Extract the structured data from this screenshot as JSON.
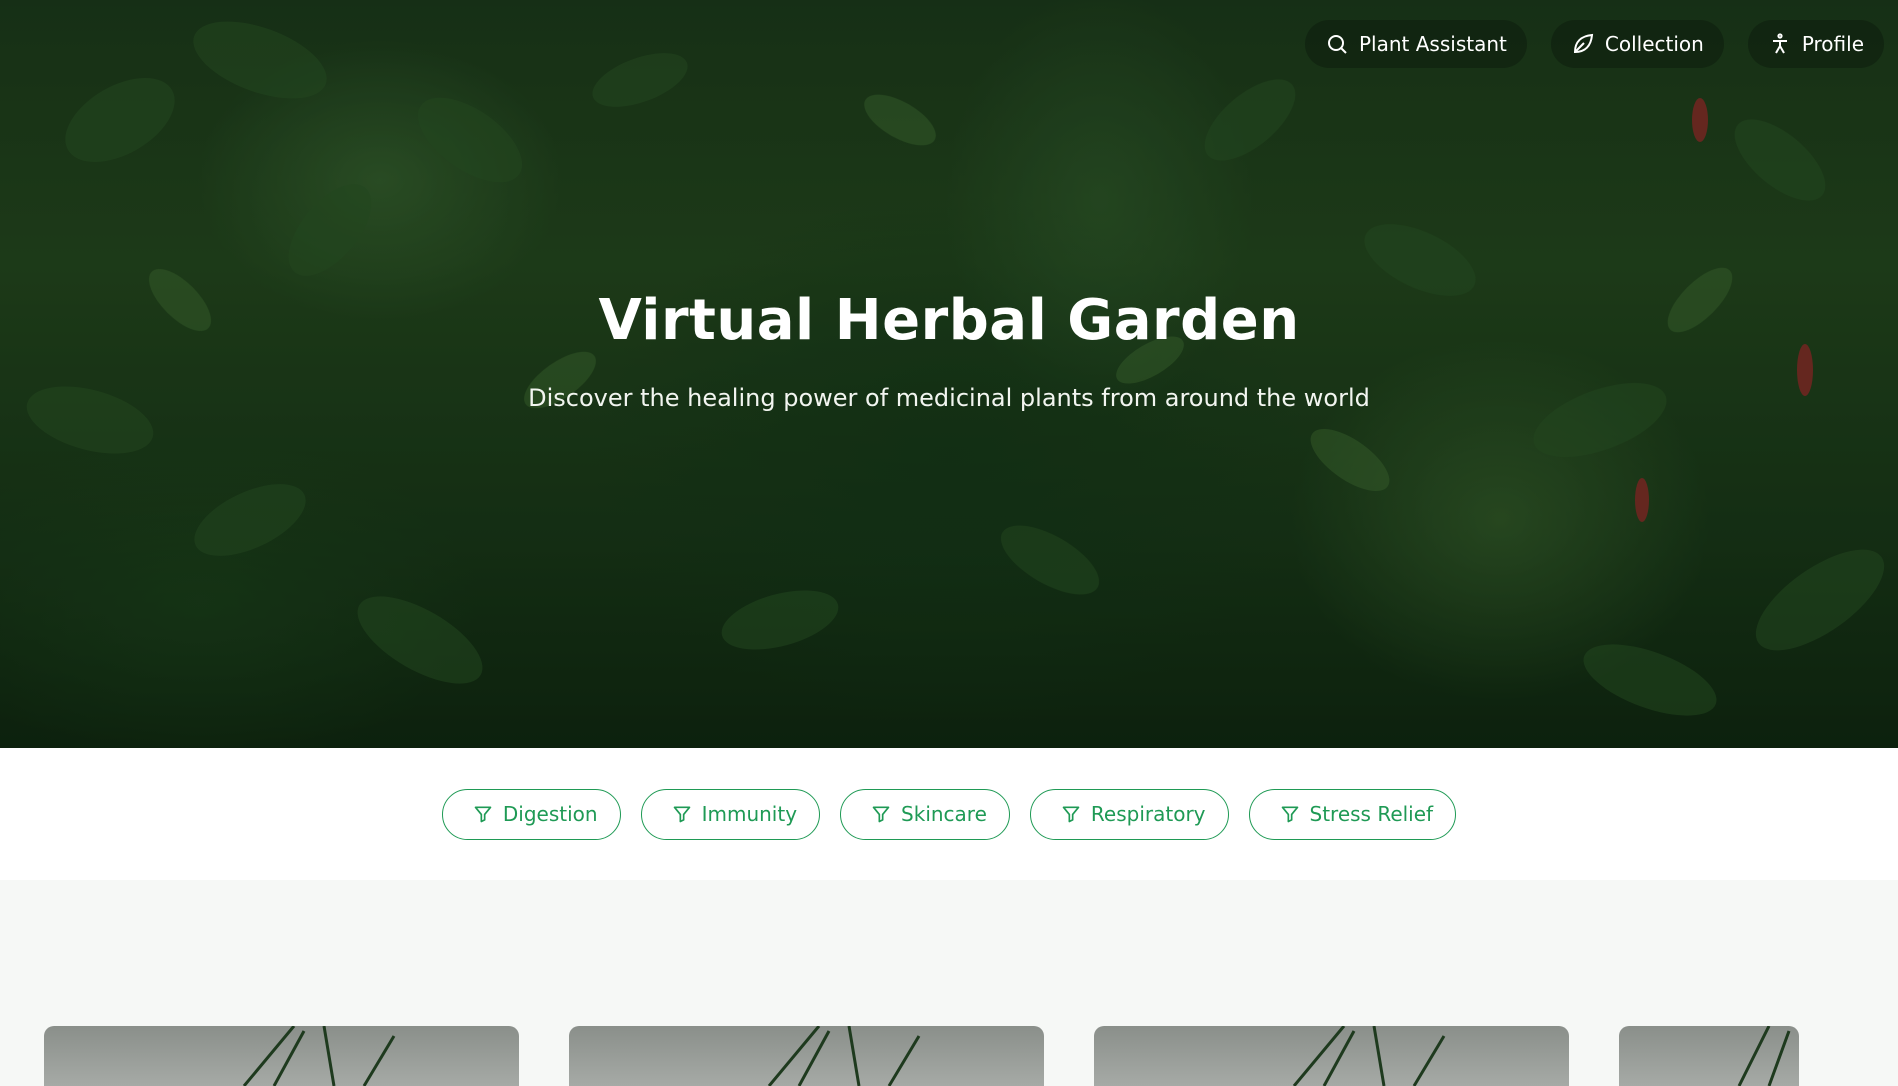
{
  "nav": {
    "items": [
      {
        "label": "Plant Assistant",
        "icon": "search-icon"
      },
      {
        "label": "Collection",
        "icon": "leaf-icon"
      },
      {
        "label": "Profile",
        "icon": "person-icon"
      }
    ]
  },
  "hero": {
    "title": "Virtual Herbal Garden",
    "subtitle": "Discover the healing power of medicinal plants from around the world"
  },
  "filters": [
    {
      "label": "Digestion",
      "icon": "filter-icon"
    },
    {
      "label": "Immunity",
      "icon": "filter-icon"
    },
    {
      "label": "Skincare",
      "icon": "filter-icon"
    },
    {
      "label": "Respiratory",
      "icon": "filter-icon"
    },
    {
      "label": "Stress Relief",
      "icon": "filter-icon"
    }
  ],
  "colors": {
    "accent": "#1f9a55",
    "hero_text": "#ffffff",
    "page_background": "#f6f8f6"
  }
}
